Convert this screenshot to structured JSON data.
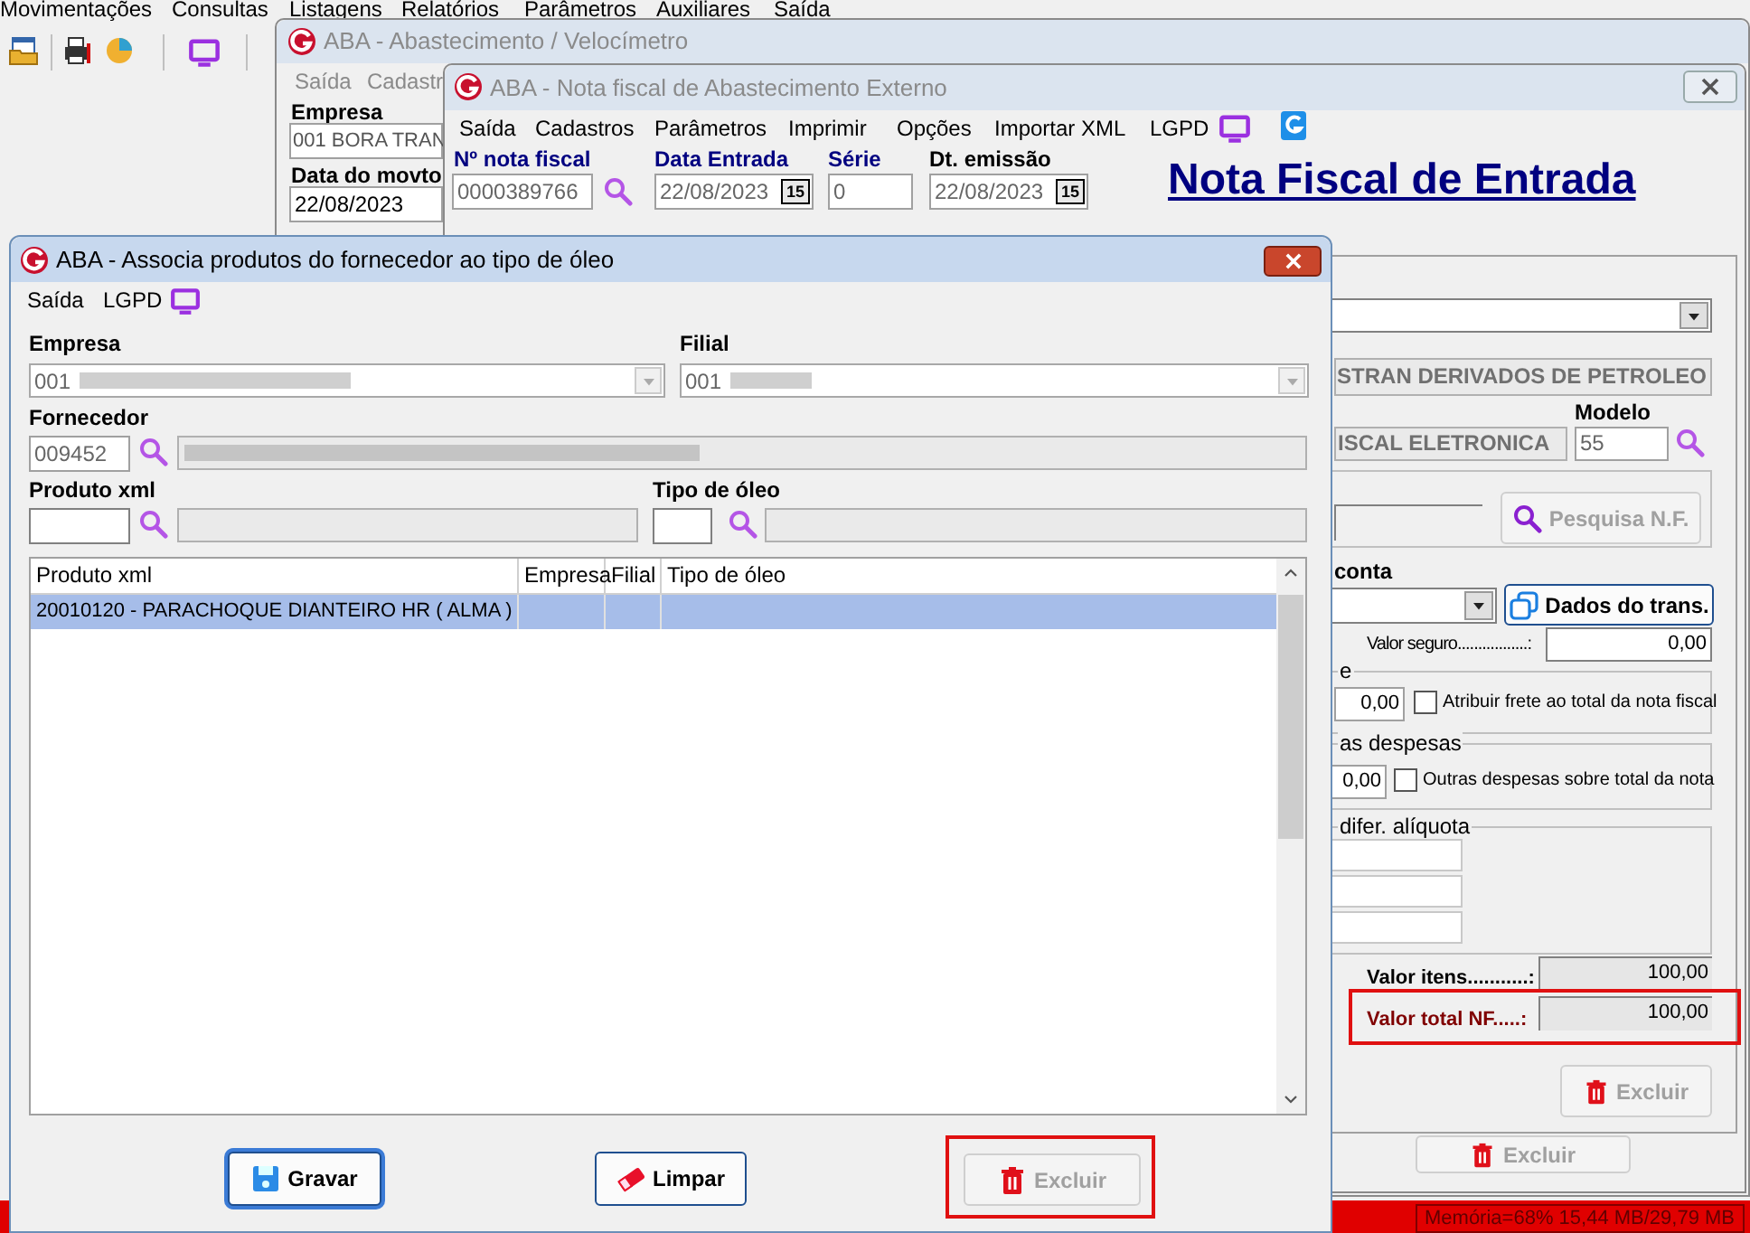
{
  "menu_bar": [
    "Movimentações",
    "Consultas",
    "Listagens",
    "Relatórios",
    "Parâmetros",
    "Auxiliares",
    "Saída"
  ],
  "window_abastecimento": {
    "title": "ABA - Abastecimento / Velocímetro",
    "menu": [
      "Saída",
      "Cadastr"
    ],
    "empresa_label": "Empresa",
    "empresa_value": "001 BORA TRAN",
    "data_label": "Data do movto",
    "data_value": "22/08/2023"
  },
  "window_nota_fiscal": {
    "title": "ABA - Nota fiscal de Abastecimento Externo",
    "menu": [
      "Saída",
      "Cadastros",
      "Parâmetros",
      "Imprimir",
      "Opções",
      "Importar XML",
      "LGPD"
    ],
    "fields": [
      {
        "label": "Nº nota fiscal",
        "value": "0000389766"
      },
      {
        "label": "Data Entrada",
        "value": "22/08/2023",
        "calendar": "15"
      },
      {
        "label": "Série",
        "value": "0"
      },
      {
        "label": "Dt. emissão",
        "value": "22/08/2023",
        "calendar": "15"
      }
    ],
    "heading": "Nota Fiscal de Entrada",
    "fornecedor_name": "STRAN DERIVADOS DE PETROLEO",
    "modelo_label": "Modelo",
    "modelo_value": "55",
    "tipo_documento": "ISCAL ELETRONICA",
    "pesquisa_button": {
      "label": "Pesquisa N.F.",
      "disabled": true
    },
    "conta_label": "conta",
    "dados_button": {
      "label": "Dados do trans.",
      "disabled": false
    },
    "valor_seguro": {
      "label": "Valor seguro.................:",
      "value": "0,00"
    },
    "frete": {
      "legend": "e",
      "value": "0,00",
      "option": {
        "label": "Atribuir frete ao total da nota fiscal",
        "checked": false
      }
    },
    "despesas": {
      "legend": "as despesas",
      "value": "0,00",
      "option": {
        "label": "Outras despesas sobre total da nota",
        "checked": false
      }
    },
    "aliquota": {
      "legend": "difer. alíquota"
    },
    "valor_itens": {
      "label": "Valor itens...........:",
      "value": "100,00"
    },
    "valor_total": {
      "label": "Valor total NF.....:",
      "value": "100,00",
      "highlighted": true
    },
    "excluir_buttons": [
      {
        "label": "Excluir",
        "disabled": true
      },
      {
        "label": "Excluir",
        "disabled": true
      }
    ]
  },
  "dialog": {
    "title": "ABA - Associa produtos do fornecedor ao tipo de óleo",
    "menu": [
      "Saída",
      "LGPD"
    ],
    "empresa": {
      "label": "Empresa",
      "value": "001"
    },
    "filial": {
      "label": "Filial",
      "value": "001"
    },
    "fornecedor": {
      "label": "Fornecedor",
      "code": "009452"
    },
    "produto": {
      "label": "Produto xml"
    },
    "tipo_oleo": {
      "label": "Tipo de óleo"
    },
    "table": {
      "columns": [
        "Produto xml",
        "Empresa",
        "Filial",
        "Tipo de óleo"
      ],
      "rows": [
        {
          "cells": [
            "20010120 - PARACHOQUE DIANTEIRO HR ( ALMA )"
          ],
          "selected": true
        }
      ]
    },
    "buttons": [
      {
        "kind": "save",
        "label": "Gravar",
        "disabled": false,
        "focused": true,
        "highlighted": false
      },
      {
        "kind": "clear",
        "label": "Limpar",
        "disabled": false,
        "focused": false,
        "highlighted": false
      },
      {
        "kind": "delete",
        "label": "Excluir",
        "disabled": true,
        "focused": false,
        "highlighted": true
      }
    ]
  },
  "status_bar": {
    "memory": "Memória=68% 15,44 MB/29,79 MB"
  }
}
